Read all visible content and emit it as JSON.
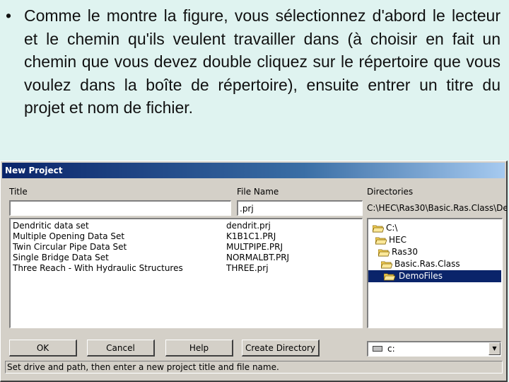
{
  "slide": {
    "bullet": "•",
    "paragraph": "Comme le montre la figure, vous sélectionnez d'abord le lecteur et le chemin qu'ils veulent travailler dans (à choisir en fait un chemin que vous devez double cliquez sur le répertoire que vous voulez dans la boîte de répertoire), ensuite entrer un titre du projet et nom de fichier."
  },
  "dialog": {
    "title": "New Project",
    "labels": {
      "title": "Title",
      "file_name": "File Name",
      "directories": "Directories"
    },
    "title_input": {
      "value": ""
    },
    "filename_input": {
      "value": ".prj"
    },
    "current_path": "C:\\HEC\\Ras30\\Basic.Ras.Class\\De",
    "projects": [
      {
        "title": "Dendritic data set",
        "file": "dendrit.prj"
      },
      {
        "title": "Multiple Opening Data Set",
        "file": "K1B1C1.PRJ"
      },
      {
        "title": "Twin Circular Pipe Data Set",
        "file": "MULTPIPE.PRJ"
      },
      {
        "title": "Single Bridge Data Set",
        "file": "NORMALBT.PRJ"
      },
      {
        "title": "Three Reach - With Hydraulic Structures",
        "file": "THREE.prj"
      }
    ],
    "directories": [
      {
        "label": "C:\\",
        "selected": false
      },
      {
        "label": "HEC",
        "selected": false
      },
      {
        "label": "Ras30",
        "selected": false
      },
      {
        "label": "Basic.Ras.Class",
        "selected": false
      },
      {
        "label": "DemoFiles",
        "selected": true
      }
    ],
    "buttons": {
      "ok": "OK",
      "cancel": "Cancel",
      "help": "Help",
      "create_directory": "Create Directory"
    },
    "drive": {
      "selected": "c:",
      "arrow": "▼"
    },
    "status": "Set drive and path, then enter a new project title and file name."
  },
  "colors": {
    "slide_background": "#dff3f0",
    "dialog_face": "#d4d0c8",
    "titlebar_start": "#0a246a",
    "titlebar_end": "#a6caf0",
    "selection": "#0a246a",
    "folder": "#f7d35a"
  }
}
